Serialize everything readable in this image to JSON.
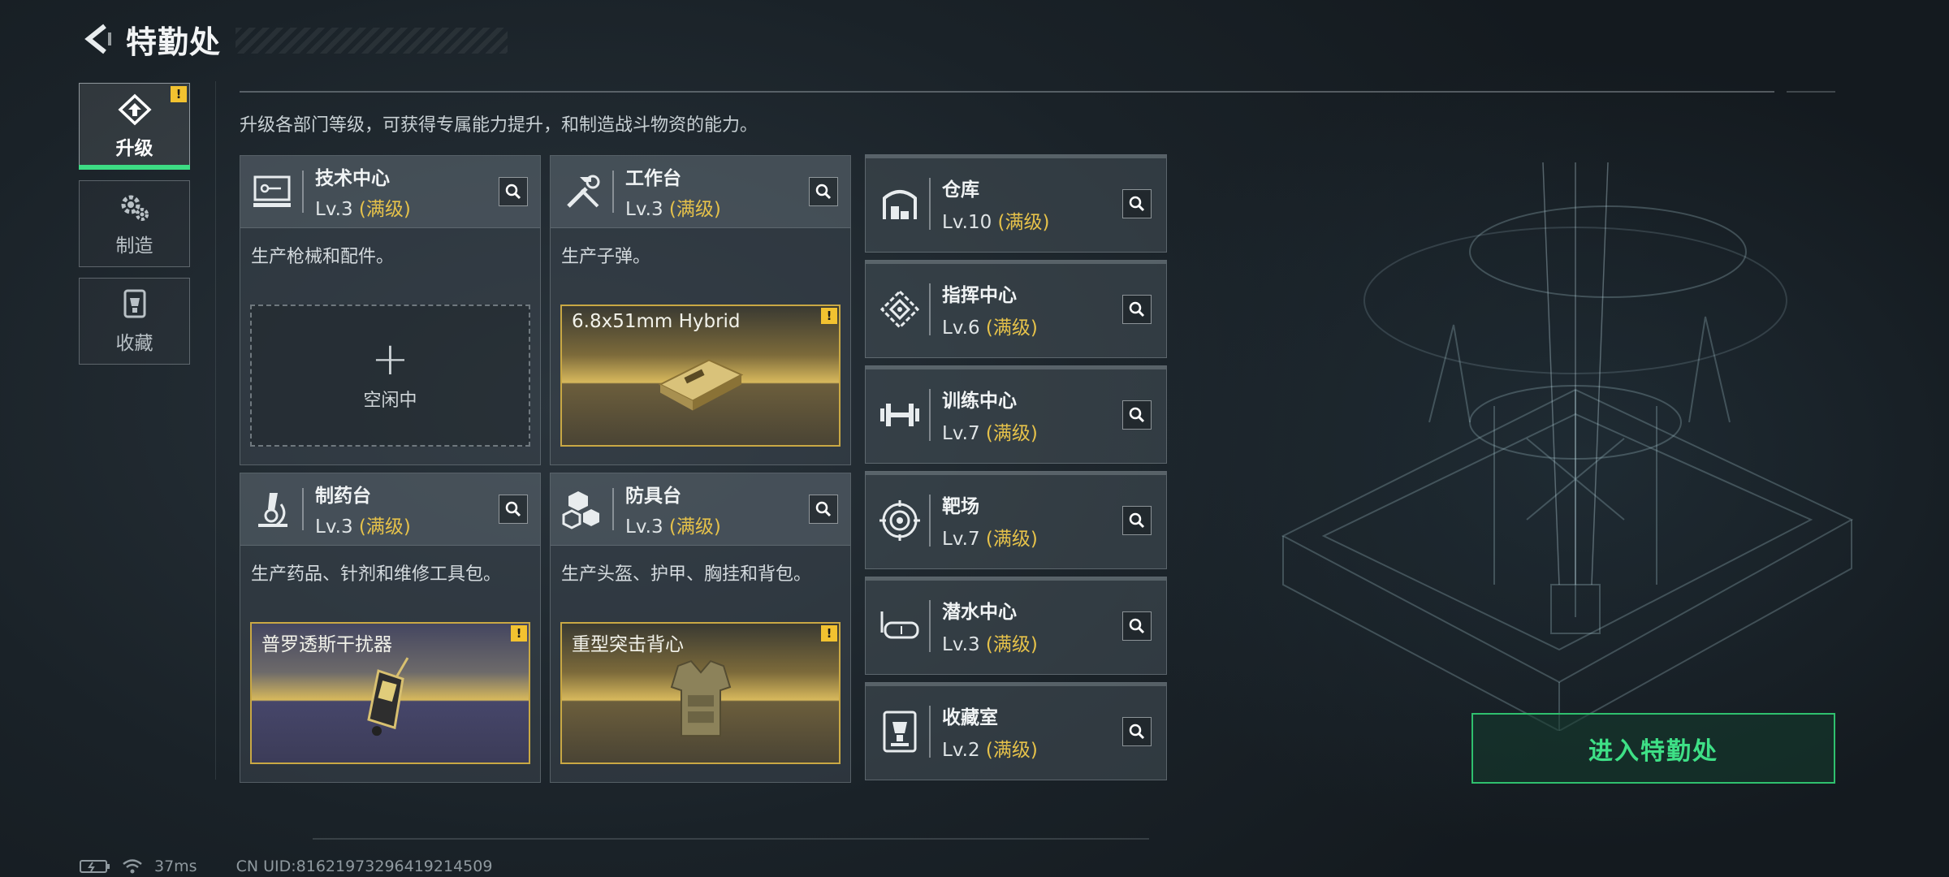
{
  "header": {
    "title": "特勤处"
  },
  "nav": [
    {
      "label": "升级",
      "icon": "upgrade-icon",
      "active": true,
      "warning": "!"
    },
    {
      "label": "制造",
      "icon": "gears-icon",
      "active": false
    },
    {
      "label": "收藏",
      "icon": "trophy-icon",
      "active": false
    }
  ],
  "main": {
    "description": "升级各部门等级，可获得专属能力提升，和制造战斗物资的能力。",
    "full_level": "(满级)",
    "cards": [
      {
        "name": "技术中心",
        "level": "Lv.3",
        "desc": "生产枪械和配件。",
        "icon": "computer-icon",
        "slot": {
          "type": "idle",
          "label": "空闲中"
        }
      },
      {
        "name": "工作台",
        "level": "Lv.3",
        "desc": "生产子弹。",
        "icon": "tools-icon",
        "slot": {
          "type": "item",
          "label": "6.8x51mm Hybrid",
          "warning": "!"
        }
      },
      {
        "name": "制药台",
        "level": "Lv.3",
        "desc": "生产药品、针剂和维修工具包。",
        "icon": "microscope-icon",
        "slot": {
          "type": "item",
          "label": "普罗透斯干扰器",
          "warning": "!"
        }
      },
      {
        "name": "防具台",
        "level": "Lv.3",
        "desc": "生产头盔、护甲、胸挂和背包。",
        "icon": "boxes-icon",
        "slot": {
          "type": "item",
          "label": "重型突击背心",
          "warning": "!"
        }
      }
    ],
    "rows": [
      {
        "name": "仓库",
        "level": "Lv.10",
        "icon": "warehouse-icon"
      },
      {
        "name": "指挥中心",
        "level": "Lv.6",
        "icon": "command-icon"
      },
      {
        "name": "训练中心",
        "level": "Lv.7",
        "icon": "dumbbell-icon"
      },
      {
        "name": "靶场",
        "level": "Lv.7",
        "icon": "target-icon"
      },
      {
        "name": "潜水中心",
        "level": "Lv.3",
        "icon": "diving-mask-icon"
      },
      {
        "name": "收藏室",
        "level": "Lv.2",
        "icon": "trophy-case-icon"
      }
    ]
  },
  "enter_button": "进入特勤处",
  "status": {
    "ping": "37ms",
    "uid": "CN UID:81621973296419214509"
  },
  "colors": {
    "accent": "#3ddc84",
    "gold": "#e6c24a",
    "warning": "#f2c230"
  }
}
